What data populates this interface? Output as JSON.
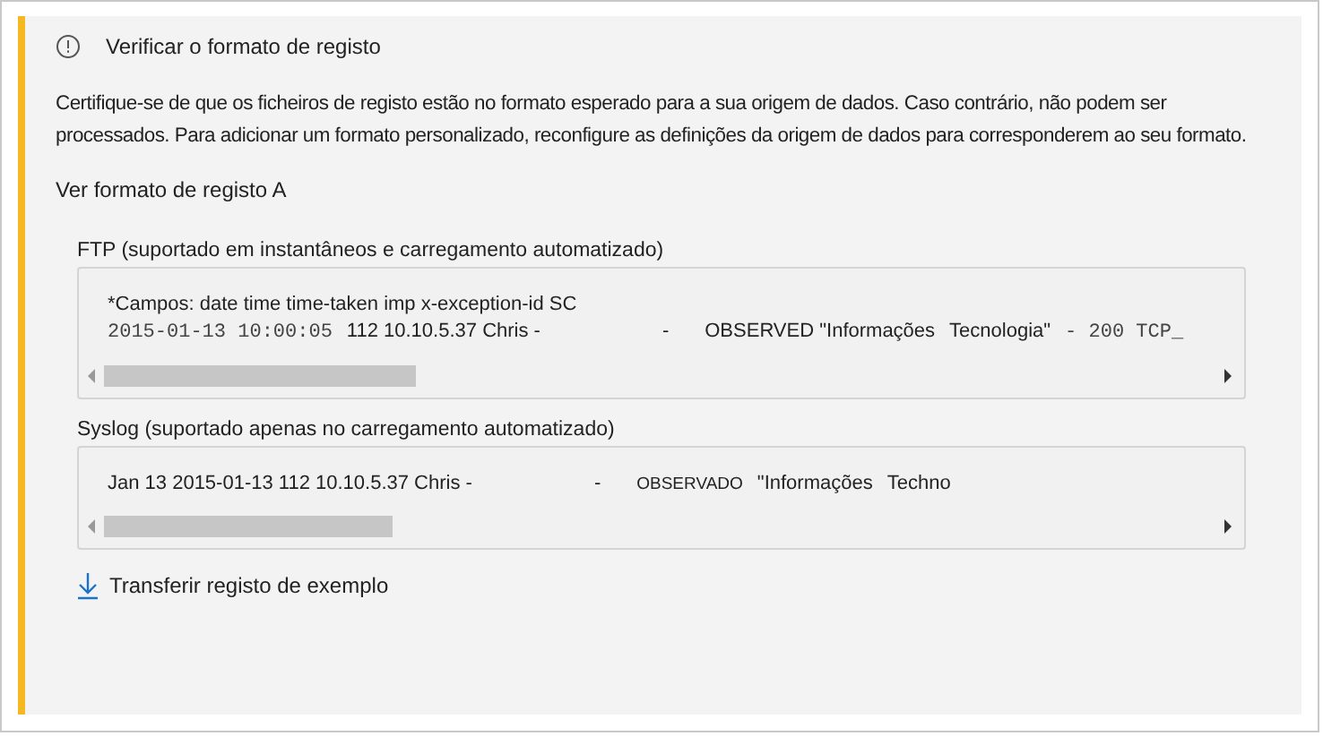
{
  "title": "Verificar o formato de registo",
  "description": "Certifique-se de que os ficheiros de registo estão no formato esperado para a sua origem de dados. Caso contrário, não podem ser processados. Para adicionar um formato personalizado, reconfigure as definições da origem de dados para corresponderem ao seu formato.",
  "format_heading": "Ver formato de registo A",
  "samples": [
    {
      "label": "FTP (suportado em instantâneos e carregamento automatizado)",
      "lines": [
        [
          {
            "kind": "sans",
            "text": "*Campos: date time time-taken imp x-exception-id SC"
          }
        ],
        [
          {
            "kind": "mono",
            "text": "2015-01-13 10:00:05"
          },
          {
            "kind": "sans",
            "text": "112 10.10.5.37 Chris -"
          },
          {
            "kind": "dash",
            "text": "-"
          },
          {
            "kind": "sans",
            "text": "OBSERVED \"Informações"
          },
          {
            "kind": "sans",
            "text": "Tecnologia\""
          },
          {
            "kind": "mono",
            "text": "- 200 TCP_"
          }
        ]
      ]
    },
    {
      "label": "Syslog (suportado apenas no carregamento automatizado)",
      "lines": [
        [
          {
            "kind": "sans",
            "text": "Jan 13 2015-01-13 112 10.10.5.37 Chris -"
          },
          {
            "kind": "dash",
            "text": "-"
          },
          {
            "kind": "small",
            "text": "OBSERVADO"
          },
          {
            "kind": "sans",
            "text": "\"Informações"
          },
          {
            "kind": "sans",
            "text": "Techno"
          }
        ]
      ]
    }
  ],
  "download_link": "Transferir registo de exemplo"
}
